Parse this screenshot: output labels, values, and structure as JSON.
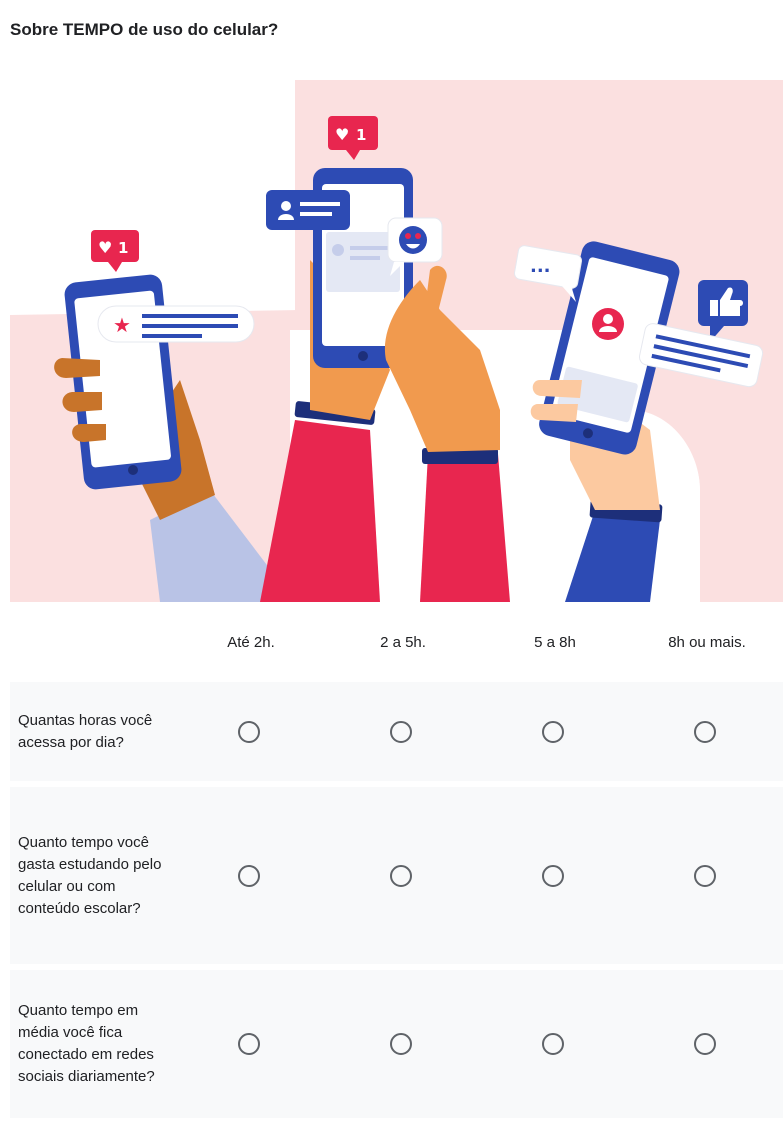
{
  "question": {
    "title": "Sobre TEMPO de uso do celular?"
  },
  "illustration": {
    "like_count_left": "1",
    "like_count_center": "1",
    "typing_dots": "..."
  },
  "grid": {
    "columns": [
      "Até 2h.",
      "2 a 5h.",
      "5 a 8h",
      "8h ou mais."
    ],
    "rows": [
      "Quantas horas você acessa por dia?",
      "Quanto tempo você gasta estudando pelo celular ou com conteúdo escolar?",
      "Quanto tempo em média você fica conectado em redes sociais diariamente?"
    ]
  },
  "colors": {
    "accent": "#e8264f",
    "phone_blue": "#2d4bb4",
    "bg_pink": "#fbe0e0"
  }
}
